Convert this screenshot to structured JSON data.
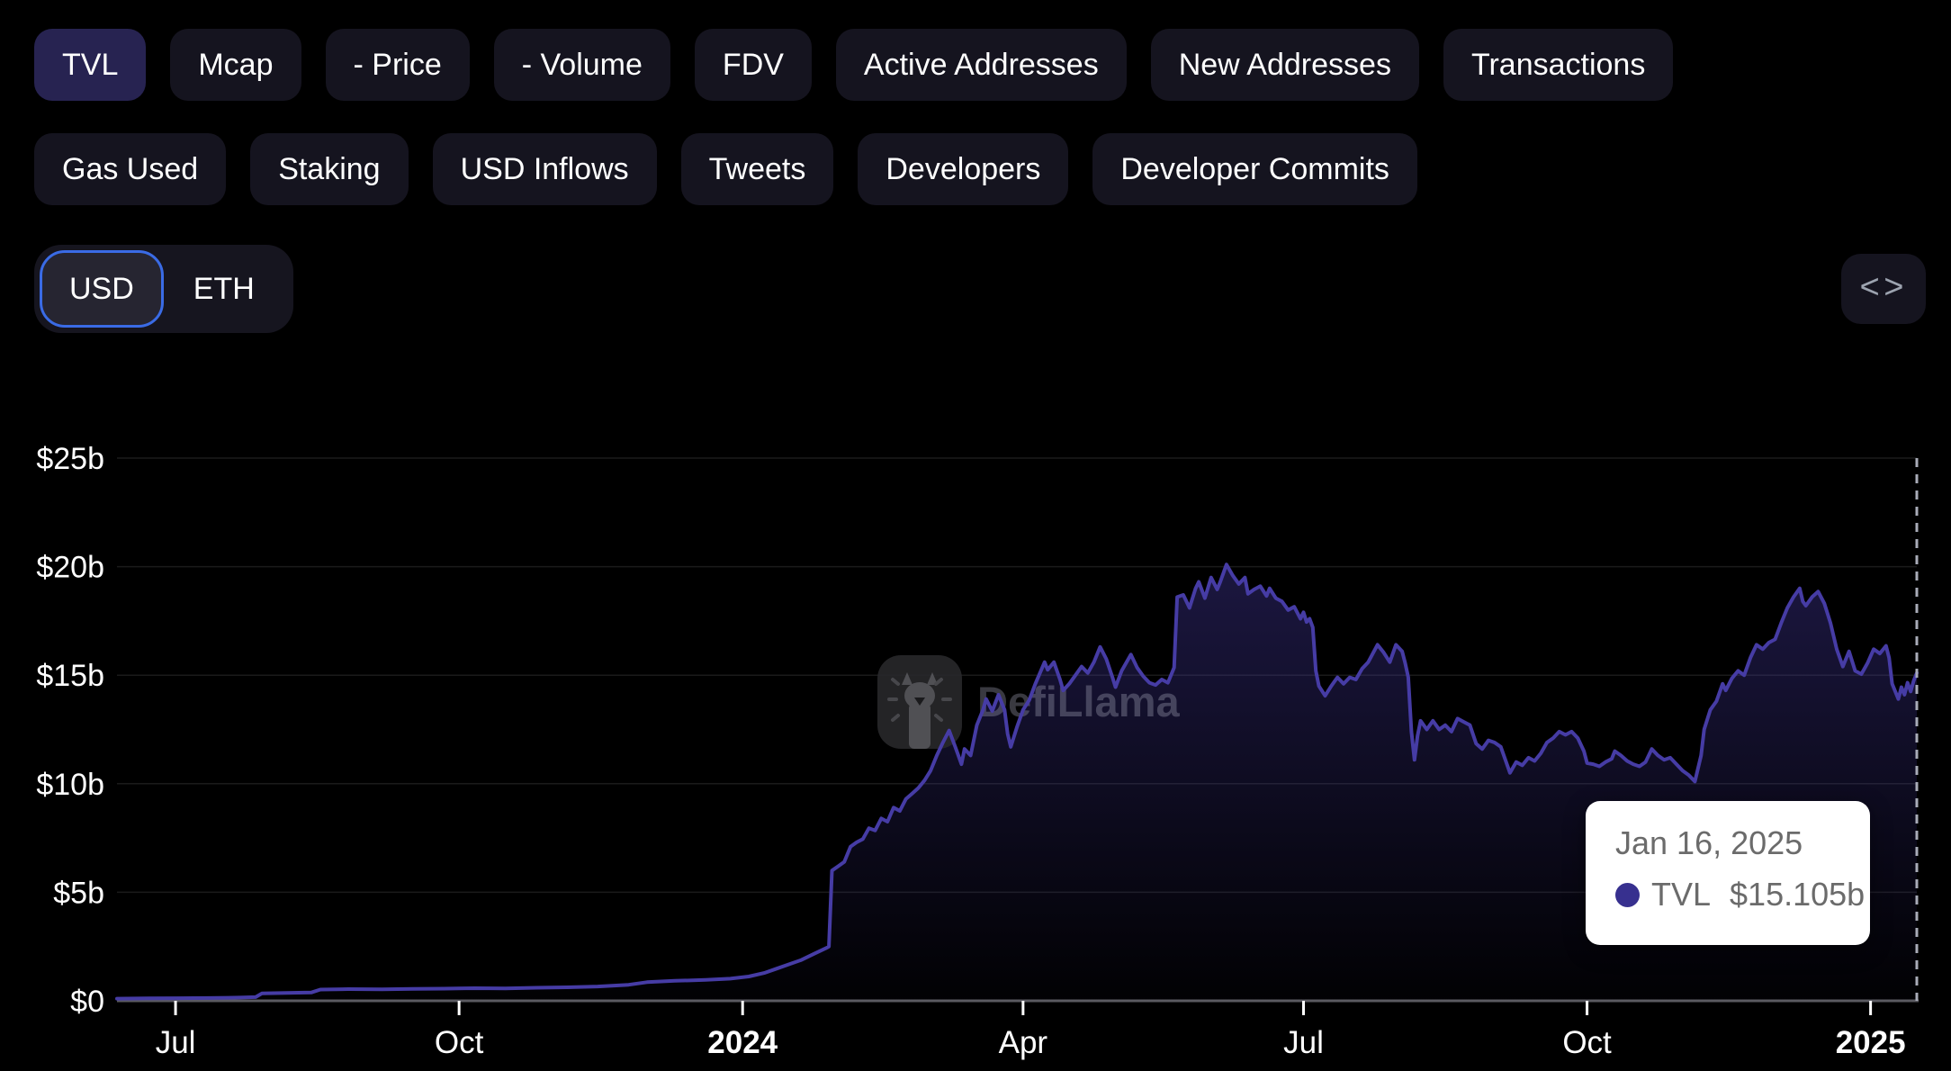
{
  "toolbar": {
    "rows": [
      [
        {
          "label": "TVL",
          "active": true
        },
        {
          "label": "Mcap"
        },
        {
          "label": "- Price"
        },
        {
          "label": "- Volume"
        },
        {
          "label": "FDV"
        },
        {
          "label": "Active Addresses"
        },
        {
          "label": "New Addresses"
        },
        {
          "label": "Transactions"
        }
      ],
      [
        {
          "label": "Gas Used"
        },
        {
          "label": "Staking"
        },
        {
          "label": "USD Inflows"
        },
        {
          "label": "Tweets"
        },
        {
          "label": "Developers"
        },
        {
          "label": "Developer Commits"
        }
      ]
    ]
  },
  "currency_toggle": {
    "options": [
      "USD",
      "ETH"
    ],
    "selected": "USD",
    "accent": "#3A6BE5"
  },
  "embed_button": {
    "icon_label": "<>"
  },
  "watermark": {
    "text": "DefiLlama"
  },
  "tooltip": {
    "date": "Jan 16, 2025",
    "series_label": "TVL",
    "value": "$15.105b",
    "marker_color": "#37308F"
  },
  "chart_data": {
    "type": "area",
    "title": "TVL",
    "currency": "USD",
    "ylim": [
      0,
      25
    ],
    "grid": true,
    "legend_position": "none",
    "x_domain": [
      "2023-06-12",
      "2025-01-16"
    ],
    "cursor_date": "2025-01-16",
    "yticks": [
      {
        "value": 0,
        "label": "$0"
      },
      {
        "value": 5,
        "label": "$5b"
      },
      {
        "value": 10,
        "label": "$10b"
      },
      {
        "value": 15,
        "label": "$15b"
      },
      {
        "value": 20,
        "label": "$20b"
      },
      {
        "value": 25,
        "label": "$25b"
      }
    ],
    "xticks": [
      {
        "date": "2023-07-01",
        "label": "Jul",
        "bold": false
      },
      {
        "date": "2023-10-01",
        "label": "Oct",
        "bold": false
      },
      {
        "date": "2024-01-01",
        "label": "2024",
        "bold": true
      },
      {
        "date": "2024-04-01",
        "label": "Apr",
        "bold": false
      },
      {
        "date": "2024-07-01",
        "label": "Jul",
        "bold": false
      },
      {
        "date": "2024-10-01",
        "label": "Oct",
        "bold": false
      },
      {
        "date": "2025-01-01",
        "label": "2025",
        "bold": true
      }
    ],
    "colors": {
      "line": "#463CA5",
      "fill_top": "rgba(72,60,168,0.38)",
      "fill_bottom": "rgba(72,60,168,0.02)",
      "axis": "#5A5A60",
      "grid": "rgba(255,255,255,0.10)",
      "dashed": "#A9ACB8",
      "tick": "#FFFFFF"
    },
    "series": [
      {
        "name": "TVL",
        "color": "#463CA5",
        "points": [
          [
            "2023-06-12",
            0.1
          ],
          [
            "2023-06-22",
            0.11
          ],
          [
            "2023-07-02",
            0.12
          ],
          [
            "2023-07-12",
            0.13
          ],
          [
            "2023-07-22",
            0.15
          ],
          [
            "2023-07-27",
            0.17
          ],
          [
            "2023-07-29",
            0.34
          ],
          [
            "2023-08-06",
            0.36
          ],
          [
            "2023-08-14",
            0.38
          ],
          [
            "2023-08-17",
            0.52
          ],
          [
            "2023-08-26",
            0.54
          ],
          [
            "2023-09-06",
            0.53
          ],
          [
            "2023-09-16",
            0.55
          ],
          [
            "2023-09-26",
            0.56
          ],
          [
            "2023-10-06",
            0.58
          ],
          [
            "2023-10-16",
            0.57
          ],
          [
            "2023-10-26",
            0.6
          ],
          [
            "2023-11-05",
            0.62
          ],
          [
            "2023-11-15",
            0.66
          ],
          [
            "2023-11-25",
            0.74
          ],
          [
            "2023-12-01",
            0.86
          ],
          [
            "2023-12-10",
            0.92
          ],
          [
            "2023-12-20",
            0.96
          ],
          [
            "2023-12-28",
            1.02
          ],
          [
            "2024-01-03",
            1.12
          ],
          [
            "2024-01-08",
            1.28
          ],
          [
            "2024-01-12",
            1.48
          ],
          [
            "2024-01-16",
            1.68
          ],
          [
            "2024-01-20",
            1.88
          ],
          [
            "2024-01-24",
            2.15
          ],
          [
            "2024-01-28",
            2.42
          ],
          [
            "2024-01-29",
            2.5
          ],
          [
            "2024-01-30",
            6.0
          ],
          [
            "2024-02-01",
            6.2
          ],
          [
            "2024-02-03",
            6.4
          ],
          [
            "2024-02-05",
            7.1
          ],
          [
            "2024-02-07",
            7.3
          ],
          [
            "2024-02-09",
            7.45
          ],
          [
            "2024-02-11",
            7.95
          ],
          [
            "2024-02-13",
            7.85
          ],
          [
            "2024-02-15",
            8.4
          ],
          [
            "2024-02-17",
            8.25
          ],
          [
            "2024-02-19",
            8.9
          ],
          [
            "2024-02-21",
            8.75
          ],
          [
            "2024-02-23",
            9.3
          ],
          [
            "2024-02-25",
            9.55
          ],
          [
            "2024-02-27",
            9.8
          ],
          [
            "2024-02-29",
            10.15
          ],
          [
            "2024-03-02",
            10.6
          ],
          [
            "2024-03-04",
            11.3
          ],
          [
            "2024-03-06",
            11.9
          ],
          [
            "2024-03-08",
            12.45
          ],
          [
            "2024-03-10",
            11.7
          ],
          [
            "2024-03-12",
            10.9
          ],
          [
            "2024-03-13",
            11.6
          ],
          [
            "2024-03-15",
            11.3
          ],
          [
            "2024-03-17",
            12.7
          ],
          [
            "2024-03-19",
            13.4
          ],
          [
            "2024-03-20",
            13.9
          ],
          [
            "2024-03-22",
            13.35
          ],
          [
            "2024-03-24",
            14.1
          ],
          [
            "2024-03-26",
            13.4
          ],
          [
            "2024-03-27",
            12.3
          ],
          [
            "2024-03-28",
            11.7
          ],
          [
            "2024-03-30",
            12.6
          ],
          [
            "2024-04-01",
            13.4
          ],
          [
            "2024-04-03",
            13.85
          ],
          [
            "2024-04-05",
            14.6
          ],
          [
            "2024-04-08",
            15.6
          ],
          [
            "2024-04-09",
            15.25
          ],
          [
            "2024-04-11",
            15.6
          ],
          [
            "2024-04-13",
            14.8
          ],
          [
            "2024-04-14",
            14.3
          ],
          [
            "2024-04-16",
            14.6
          ],
          [
            "2024-04-18",
            15.0
          ],
          [
            "2024-04-20",
            15.4
          ],
          [
            "2024-04-22",
            15.1
          ],
          [
            "2024-04-24",
            15.6
          ],
          [
            "2024-04-26",
            16.3
          ],
          [
            "2024-04-28",
            15.75
          ],
          [
            "2024-04-30",
            14.9
          ],
          [
            "2024-05-01",
            14.45
          ],
          [
            "2024-05-03",
            15.2
          ],
          [
            "2024-05-06",
            15.95
          ],
          [
            "2024-05-08",
            15.35
          ],
          [
            "2024-05-10",
            14.95
          ],
          [
            "2024-05-12",
            14.65
          ],
          [
            "2024-05-14",
            14.55
          ],
          [
            "2024-05-16",
            14.8
          ],
          [
            "2024-05-18",
            14.65
          ],
          [
            "2024-05-20",
            15.35
          ],
          [
            "2024-05-21",
            18.6
          ],
          [
            "2024-05-23",
            18.7
          ],
          [
            "2024-05-25",
            18.1
          ],
          [
            "2024-05-27",
            19.0
          ],
          [
            "2024-05-28",
            19.3
          ],
          [
            "2024-05-30",
            18.55
          ],
          [
            "2024-06-01",
            19.5
          ],
          [
            "2024-06-03",
            18.95
          ],
          [
            "2024-06-04",
            19.3
          ],
          [
            "2024-06-06",
            20.1
          ],
          [
            "2024-06-08",
            19.6
          ],
          [
            "2024-06-10",
            19.2
          ],
          [
            "2024-06-12",
            19.5
          ],
          [
            "2024-06-13",
            18.75
          ],
          [
            "2024-06-15",
            18.95
          ],
          [
            "2024-06-17",
            19.1
          ],
          [
            "2024-06-19",
            18.65
          ],
          [
            "2024-06-20",
            19.0
          ],
          [
            "2024-06-22",
            18.55
          ],
          [
            "2024-06-24",
            18.4
          ],
          [
            "2024-06-26",
            18.0
          ],
          [
            "2024-06-28",
            18.15
          ],
          [
            "2024-06-30",
            17.6
          ],
          [
            "2024-07-01",
            17.9
          ],
          [
            "2024-07-02",
            17.45
          ],
          [
            "2024-07-03",
            17.6
          ],
          [
            "2024-07-04",
            17.2
          ],
          [
            "2024-07-05",
            15.2
          ],
          [
            "2024-07-06",
            14.5
          ],
          [
            "2024-07-08",
            14.05
          ],
          [
            "2024-07-10",
            14.5
          ],
          [
            "2024-07-12",
            14.9
          ],
          [
            "2024-07-14",
            14.6
          ],
          [
            "2024-07-16",
            14.9
          ],
          [
            "2024-07-18",
            14.8
          ],
          [
            "2024-07-20",
            15.3
          ],
          [
            "2024-07-22",
            15.6
          ],
          [
            "2024-07-25",
            16.4
          ],
          [
            "2024-07-27",
            16.05
          ],
          [
            "2024-07-29",
            15.6
          ],
          [
            "2024-07-31",
            16.4
          ],
          [
            "2024-08-02",
            16.1
          ],
          [
            "2024-08-03",
            15.55
          ],
          [
            "2024-08-04",
            14.9
          ],
          [
            "2024-08-05",
            12.4
          ],
          [
            "2024-08-06",
            11.1
          ],
          [
            "2024-08-07",
            12.2
          ],
          [
            "2024-08-08",
            12.9
          ],
          [
            "2024-08-10",
            12.5
          ],
          [
            "2024-08-12",
            12.9
          ],
          [
            "2024-08-14",
            12.5
          ],
          [
            "2024-08-16",
            12.7
          ],
          [
            "2024-08-18",
            12.4
          ],
          [
            "2024-08-20",
            13.0
          ],
          [
            "2024-08-22",
            12.85
          ],
          [
            "2024-08-24",
            12.7
          ],
          [
            "2024-08-26",
            11.85
          ],
          [
            "2024-08-28",
            11.6
          ],
          [
            "2024-08-30",
            12.0
          ],
          [
            "2024-09-01",
            11.9
          ],
          [
            "2024-09-03",
            11.7
          ],
          [
            "2024-09-06",
            10.5
          ],
          [
            "2024-09-08",
            11.0
          ],
          [
            "2024-09-10",
            10.85
          ],
          [
            "2024-09-12",
            11.2
          ],
          [
            "2024-09-14",
            11.05
          ],
          [
            "2024-09-16",
            11.4
          ],
          [
            "2024-09-18",
            11.9
          ],
          [
            "2024-09-20",
            12.1
          ],
          [
            "2024-09-22",
            12.4
          ],
          [
            "2024-09-24",
            12.25
          ],
          [
            "2024-09-26",
            12.4
          ],
          [
            "2024-09-28",
            12.1
          ],
          [
            "2024-09-30",
            11.5
          ],
          [
            "2024-10-01",
            10.95
          ],
          [
            "2024-10-03",
            10.9
          ],
          [
            "2024-10-05",
            10.8
          ],
          [
            "2024-10-07",
            11.0
          ],
          [
            "2024-10-09",
            11.15
          ],
          [
            "2024-10-10",
            11.5
          ],
          [
            "2024-10-12",
            11.3
          ],
          [
            "2024-10-14",
            11.05
          ],
          [
            "2024-10-16",
            10.9
          ],
          [
            "2024-10-18",
            10.8
          ],
          [
            "2024-10-20",
            11.0
          ],
          [
            "2024-10-22",
            11.6
          ],
          [
            "2024-10-24",
            11.3
          ],
          [
            "2024-10-26",
            11.1
          ],
          [
            "2024-10-28",
            11.2
          ],
          [
            "2024-10-30",
            10.9
          ],
          [
            "2024-11-01",
            10.6
          ],
          [
            "2024-11-03",
            10.4
          ],
          [
            "2024-11-05",
            10.1
          ],
          [
            "2024-11-07",
            11.3
          ],
          [
            "2024-11-08",
            12.5
          ],
          [
            "2024-11-10",
            13.4
          ],
          [
            "2024-11-12",
            13.8
          ],
          [
            "2024-11-14",
            14.6
          ],
          [
            "2024-11-15",
            14.3
          ],
          [
            "2024-11-17",
            14.85
          ],
          [
            "2024-11-19",
            15.2
          ],
          [
            "2024-11-21",
            15.0
          ],
          [
            "2024-11-23",
            15.8
          ],
          [
            "2024-11-25",
            16.4
          ],
          [
            "2024-11-27",
            16.2
          ],
          [
            "2024-11-29",
            16.5
          ],
          [
            "2024-12-01",
            16.65
          ],
          [
            "2024-12-03",
            17.4
          ],
          [
            "2024-12-05",
            18.1
          ],
          [
            "2024-12-07",
            18.6
          ],
          [
            "2024-12-09",
            19.0
          ],
          [
            "2024-12-10",
            18.4
          ],
          [
            "2024-12-11",
            18.2
          ],
          [
            "2024-12-13",
            18.6
          ],
          [
            "2024-12-15",
            18.85
          ],
          [
            "2024-12-17",
            18.3
          ],
          [
            "2024-12-19",
            17.4
          ],
          [
            "2024-12-21",
            16.2
          ],
          [
            "2024-12-23",
            15.4
          ],
          [
            "2024-12-25",
            16.1
          ],
          [
            "2024-12-27",
            15.2
          ],
          [
            "2024-12-29",
            15.05
          ],
          [
            "2024-12-31",
            15.55
          ],
          [
            "2025-01-02",
            16.2
          ],
          [
            "2025-01-04",
            16.0
          ],
          [
            "2025-01-06",
            16.35
          ],
          [
            "2025-01-07",
            15.8
          ],
          [
            "2025-01-08",
            14.6
          ],
          [
            "2025-01-10",
            13.9
          ],
          [
            "2025-01-11",
            14.45
          ],
          [
            "2025-01-12",
            14.1
          ],
          [
            "2025-01-13",
            14.65
          ],
          [
            "2025-01-14",
            14.25
          ],
          [
            "2025-01-15",
            14.75
          ],
          [
            "2025-01-16",
            15.105
          ]
        ]
      }
    ]
  }
}
